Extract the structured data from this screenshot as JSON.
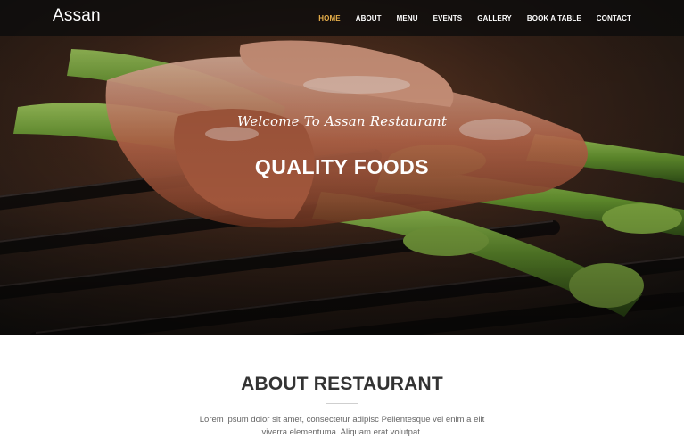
{
  "brand": {
    "name": "Assan"
  },
  "nav": {
    "items": [
      {
        "label": "HOME",
        "active": true
      },
      {
        "label": "ABOUT",
        "active": false
      },
      {
        "label": "MENU",
        "active": false
      },
      {
        "label": "EVENTS",
        "active": false
      },
      {
        "label": "GALLERY",
        "active": false
      },
      {
        "label": "BOOK A TABLE",
        "active": false
      },
      {
        "label": "CONTACT",
        "active": false
      }
    ]
  },
  "hero": {
    "welcome": "Welcome To Assan Restaurant",
    "title": "QUALITY FOODS"
  },
  "about": {
    "title": "ABOUT RESTAURANT",
    "text": "Lorem ipsum dolor sit amet, consectetur adipisc Pellentesque vel enim a elit viverra elementuma. Aliquam erat volutpat."
  },
  "colors": {
    "accent": "#e8b04a",
    "nav_bg": "#0c0c0c",
    "heading": "#333333",
    "body_text": "#666666"
  }
}
